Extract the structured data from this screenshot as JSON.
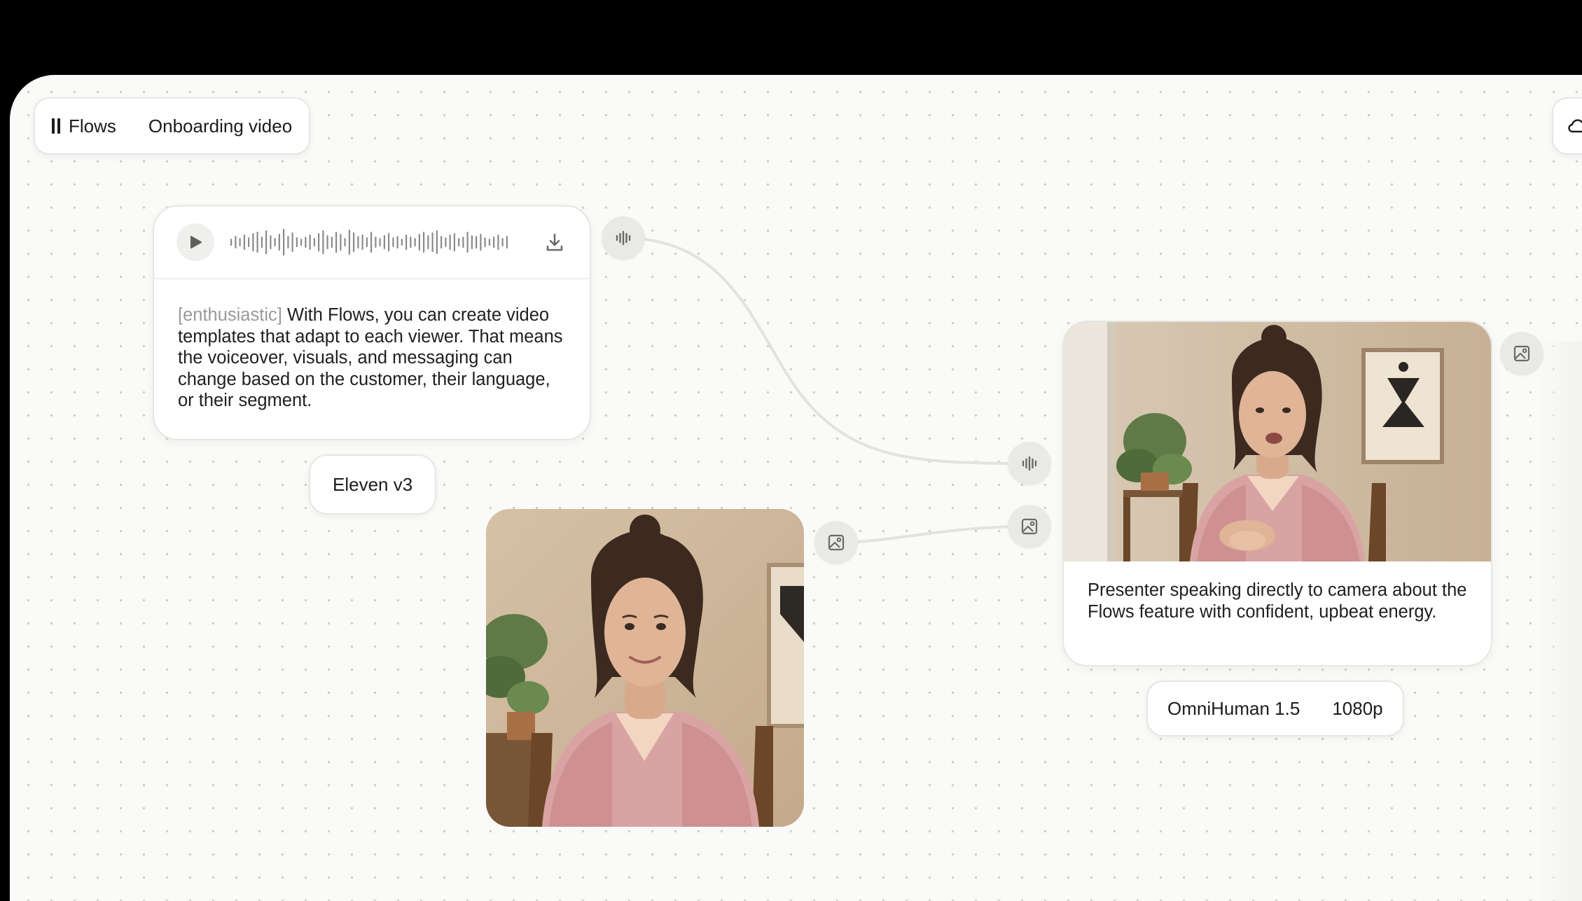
{
  "breadcrumb": {
    "app_label": "Flows",
    "app_icon": "flows-bars-icon",
    "page_label": "Onboarding video"
  },
  "audio_node": {
    "play_icon": "play-icon",
    "download_icon": "download-icon",
    "tone_tag": "[enthusiastic]",
    "script": "With Flows, you can create video templates that adapt to each viewer. That means the voiceover, visuals, and messaging can change based on the customer, their language, or their segment.",
    "model": "Eleven v3"
  },
  "video_node": {
    "prompt": "Presenter speaking directly to camera about the Flows feature with confident, upbeat energy.",
    "model": "OmniHuman 1.5",
    "resolution": "1080p"
  },
  "icons": {
    "audio_port": "audio-wave-icon",
    "image_port": "image-icon",
    "cloud": "cloud-icon"
  },
  "colors": {
    "canvas": "#fafaf9",
    "dot": "#cfcfcb",
    "wire": "#e2e2df",
    "port": "#e9e9e7",
    "tone_text": "#9a9a98"
  }
}
